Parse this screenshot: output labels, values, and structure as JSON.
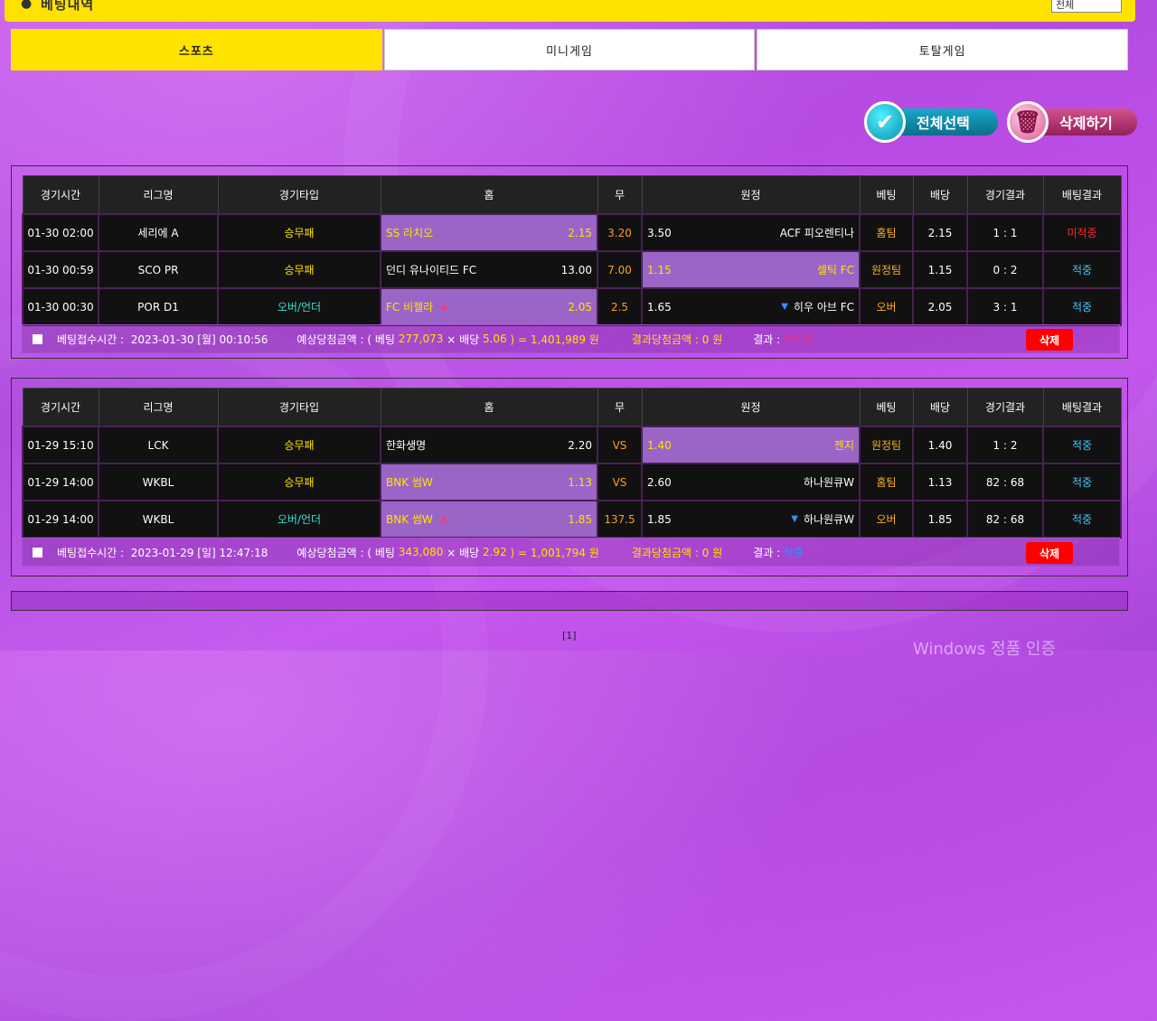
{
  "header": {
    "title": "베팅내역",
    "select_value": "전체"
  },
  "tabs": [
    {
      "label": "스포츠",
      "active": true
    },
    {
      "label": "미니게임",
      "active": false
    },
    {
      "label": "토탈게임",
      "active": false
    }
  ],
  "actions": {
    "select_all": "전체선택",
    "delete_all": "삭제하기"
  },
  "columns": [
    "경기시간",
    "리그명",
    "경기타입",
    "홈",
    "무",
    "원정",
    "베팅",
    "배당",
    "경기결과",
    "배팅결과"
  ],
  "bets": [
    {
      "rows": [
        {
          "time": "01-30 02:00",
          "league": "세리에 A",
          "type": "승무패",
          "home": "SS 라치오",
          "home_odds": "2.15",
          "draw": "3.20",
          "away_odds": "3.50",
          "away": "ACF 피오렌티나",
          "bet": "홈팀",
          "odds": "2.15",
          "score": "1 : 1",
          "result": "미적중"
        },
        {
          "time": "01-30 00:59",
          "league": "SCO PR",
          "type": "승무패",
          "home": "던디 유나이티드 FC",
          "home_odds": "13.00",
          "draw": "7.00",
          "away_odds": "1.15",
          "away": "셀틱 FC",
          "bet": "원정팀",
          "odds": "1.15",
          "score": "0 : 2",
          "result": "적중"
        },
        {
          "time": "01-30 00:30",
          "league": "POR D1",
          "type": "오버/언더",
          "home": "FC 비젤라",
          "home_odds": "2.05",
          "draw": "2.5",
          "away_odds": "1.65",
          "away": "히우 아브 FC",
          "bet": "오버",
          "odds": "2.05",
          "score": "3 : 1",
          "result": "적중"
        }
      ],
      "summary": {
        "time_label": "베팅접수시간 :",
        "time": "2023-01-30 [월] 00:10:56",
        "expected_label": "예상당첨금액 : ( 베팅",
        "stake": "277,073",
        "times": "× 배당",
        "total_odds": "5.06",
        "eq": ") = 1,401,989 원",
        "won_label": "결과당첨금액 : 0 원",
        "result_label": "결과 :",
        "result": "미적중",
        "delete": "삭제"
      }
    },
    {
      "rows": [
        {
          "time": "01-29 15:10",
          "league": "LCK",
          "type": "승무패",
          "home": "한화생명",
          "home_odds": "2.20",
          "draw": "VS",
          "away_odds": "1.40",
          "away": "젠지",
          "bet": "원정팀",
          "odds": "1.40",
          "score": "1 : 2",
          "result": "적중"
        },
        {
          "time": "01-29 14:00",
          "league": "WKBL",
          "type": "승무패",
          "home": "BNK 썸W",
          "home_odds": "1.13",
          "draw": "VS",
          "away_odds": "2.60",
          "away": "하나원큐W",
          "bet": "홈팀",
          "odds": "1.13",
          "score": "82 : 68",
          "result": "적중"
        },
        {
          "time": "01-29 14:00",
          "league": "WKBL",
          "type": "오버/언더",
          "home": "BNK 썸W",
          "home_odds": "1.85",
          "draw": "137.5",
          "away_odds": "1.85",
          "away": "하나원큐W",
          "bet": "오버",
          "odds": "1.85",
          "score": "82 : 68",
          "result": "적중"
        }
      ],
      "summary": {
        "time_label": "베팅접수시간 :",
        "time": "2023-01-29 [일] 12:47:18",
        "expected_label": "예상당첨금액 : ( 베팅",
        "stake": "343,080",
        "times": "× 배당",
        "total_odds": "2.92",
        "eq": ") = 1,001,794 원",
        "won_label": "결과당첨금액 : 0 원",
        "result_label": "결과 :",
        "result": "적중",
        "delete": "삭제"
      }
    }
  ],
  "pagination": "[1]",
  "watermark": "Windows 정품 인증"
}
